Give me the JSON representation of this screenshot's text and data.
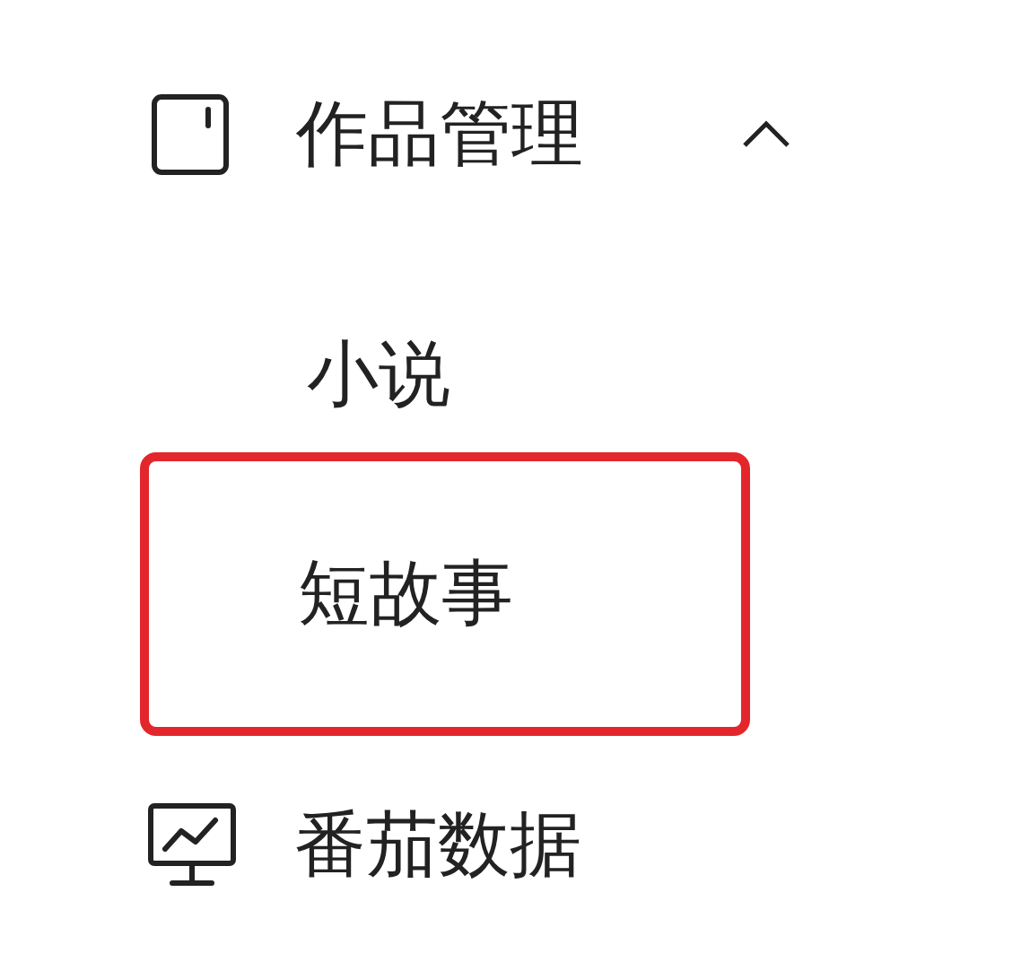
{
  "menu": [
    {
      "kind": "document",
      "label": "作品管理",
      "expanded": true,
      "children": [
        {
          "label": "小说",
          "highlighted": false
        },
        {
          "label": "短故事",
          "highlighted": true
        }
      ]
    },
    {
      "kind": "monitor",
      "label": "番茄数据"
    }
  ]
}
